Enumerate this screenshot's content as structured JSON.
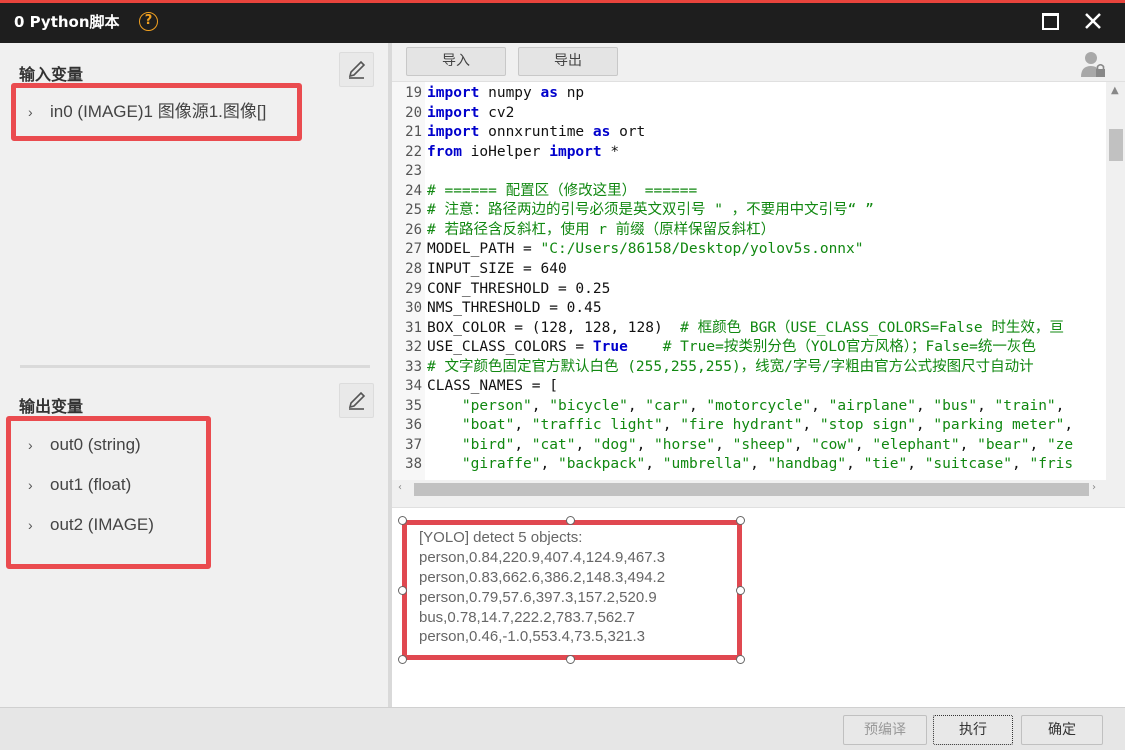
{
  "window": {
    "title": "0 Python脚本",
    "help_glyph": "?"
  },
  "inputs": {
    "title": "输入变量",
    "items": [
      {
        "label": "in0 (IMAGE)1 图像源1.图像[]"
      }
    ]
  },
  "outputs": {
    "title": "输出变量",
    "items": [
      {
        "label": "out0 (string)"
      },
      {
        "label": "out1 (float)"
      },
      {
        "label": "out2 (IMAGE)"
      }
    ]
  },
  "toolbar": {
    "import_label": "导入",
    "export_label": "导出"
  },
  "code": {
    "lines": [
      {
        "n": "19",
        "segs": [
          {
            "t": "import",
            "c": "kw"
          },
          {
            "t": " numpy ",
            "c": ""
          },
          {
            "t": "as",
            "c": "kw"
          },
          {
            "t": " np",
            "c": ""
          }
        ]
      },
      {
        "n": "20",
        "segs": [
          {
            "t": "import",
            "c": "kw"
          },
          {
            "t": " cv2",
            "c": ""
          }
        ]
      },
      {
        "n": "21",
        "segs": [
          {
            "t": "import",
            "c": "kw"
          },
          {
            "t": " onnxruntime ",
            "c": ""
          },
          {
            "t": "as",
            "c": "kw"
          },
          {
            "t": " ort",
            "c": ""
          }
        ]
      },
      {
        "n": "22",
        "segs": [
          {
            "t": "from",
            "c": "kw"
          },
          {
            "t": " ioHelper ",
            "c": ""
          },
          {
            "t": "import",
            "c": "kw"
          },
          {
            "t": " *",
            "c": ""
          }
        ]
      },
      {
        "n": "23",
        "segs": []
      },
      {
        "n": "24",
        "segs": [
          {
            "t": "# ====== 配置区（修改这里） ======",
            "c": "cm"
          }
        ]
      },
      {
        "n": "25",
        "segs": [
          {
            "t": "# 注意：路径两边的引号必须是英文双引号 \" ，不要用中文引号“ ”",
            "c": "cm"
          }
        ]
      },
      {
        "n": "26",
        "segs": [
          {
            "t": "# 若路径含反斜杠，使用 r 前缀（原样保留反斜杠）",
            "c": "cm"
          }
        ]
      },
      {
        "n": "27",
        "segs": [
          {
            "t": "MODEL_PATH = ",
            "c": ""
          },
          {
            "t": "\"C:/Users/86158/Desktop/yolov5s.onnx\"",
            "c": "st"
          }
        ]
      },
      {
        "n": "28",
        "segs": [
          {
            "t": "INPUT_SIZE = 640",
            "c": ""
          }
        ]
      },
      {
        "n": "29",
        "segs": [
          {
            "t": "CONF_THRESHOLD = 0.25",
            "c": ""
          }
        ]
      },
      {
        "n": "30",
        "segs": [
          {
            "t": "NMS_THRESHOLD = 0.45",
            "c": ""
          }
        ]
      },
      {
        "n": "31",
        "segs": [
          {
            "t": "BOX_COLOR = (128, 128, 128)  ",
            "c": ""
          },
          {
            "t": "# 框颜色 BGR（USE_CLASS_COLORS=False 时生效，亘",
            "c": "cm"
          }
        ]
      },
      {
        "n": "32",
        "segs": [
          {
            "t": "USE_CLASS_COLORS = ",
            "c": ""
          },
          {
            "t": "True",
            "c": "kw"
          },
          {
            "t": "    ",
            "c": ""
          },
          {
            "t": "# True=按类别分色（YOLO官方风格）；False=统一灰色",
            "c": "cm"
          }
        ]
      },
      {
        "n": "33",
        "segs": [
          {
            "t": "# 文字颜色固定官方默认白色 (255,255,255)，线宽/字号/字粗由官方公式按图尺寸自动计",
            "c": "cm"
          }
        ]
      },
      {
        "n": "34",
        "segs": [
          {
            "t": "CLASS_NAMES = [",
            "c": ""
          }
        ]
      },
      {
        "n": "35",
        "segs": [
          {
            "t": "    ",
            "c": ""
          },
          {
            "t": "\"person\"",
            "c": "st"
          },
          {
            "t": ", ",
            "c": ""
          },
          {
            "t": "\"bicycle\"",
            "c": "st"
          },
          {
            "t": ", ",
            "c": ""
          },
          {
            "t": "\"car\"",
            "c": "st"
          },
          {
            "t": ", ",
            "c": ""
          },
          {
            "t": "\"motorcycle\"",
            "c": "st"
          },
          {
            "t": ", ",
            "c": ""
          },
          {
            "t": "\"airplane\"",
            "c": "st"
          },
          {
            "t": ", ",
            "c": ""
          },
          {
            "t": "\"bus\"",
            "c": "st"
          },
          {
            "t": ", ",
            "c": ""
          },
          {
            "t": "\"train\"",
            "c": "st"
          },
          {
            "t": ",",
            "c": ""
          }
        ]
      },
      {
        "n": "36",
        "segs": [
          {
            "t": "    ",
            "c": ""
          },
          {
            "t": "\"boat\"",
            "c": "st"
          },
          {
            "t": ", ",
            "c": ""
          },
          {
            "t": "\"traffic light\"",
            "c": "st"
          },
          {
            "t": ", ",
            "c": ""
          },
          {
            "t": "\"fire hydrant\"",
            "c": "st"
          },
          {
            "t": ", ",
            "c": ""
          },
          {
            "t": "\"stop sign\"",
            "c": "st"
          },
          {
            "t": ", ",
            "c": ""
          },
          {
            "t": "\"parking meter\"",
            "c": "st"
          },
          {
            "t": ",",
            "c": ""
          }
        ]
      },
      {
        "n": "37",
        "segs": [
          {
            "t": "    ",
            "c": ""
          },
          {
            "t": "\"bird\"",
            "c": "st"
          },
          {
            "t": ", ",
            "c": ""
          },
          {
            "t": "\"cat\"",
            "c": "st"
          },
          {
            "t": ", ",
            "c": ""
          },
          {
            "t": "\"dog\"",
            "c": "st"
          },
          {
            "t": ", ",
            "c": ""
          },
          {
            "t": "\"horse\"",
            "c": "st"
          },
          {
            "t": ", ",
            "c": ""
          },
          {
            "t": "\"sheep\"",
            "c": "st"
          },
          {
            "t": ", ",
            "c": ""
          },
          {
            "t": "\"cow\"",
            "c": "st"
          },
          {
            "t": ", ",
            "c": ""
          },
          {
            "t": "\"elephant\"",
            "c": "st"
          },
          {
            "t": ", ",
            "c": ""
          },
          {
            "t": "\"bear\"",
            "c": "st"
          },
          {
            "t": ", ",
            "c": ""
          },
          {
            "t": "\"ze",
            "c": "st"
          }
        ]
      },
      {
        "n": "38",
        "segs": [
          {
            "t": "    ",
            "c": ""
          },
          {
            "t": "\"giraffe\"",
            "c": "st"
          },
          {
            "t": ", ",
            "c": ""
          },
          {
            "t": "\"backpack\"",
            "c": "st"
          },
          {
            "t": ", ",
            "c": ""
          },
          {
            "t": "\"umbrella\"",
            "c": "st"
          },
          {
            "t": ", ",
            "c": ""
          },
          {
            "t": "\"handbag\"",
            "c": "st"
          },
          {
            "t": ", ",
            "c": ""
          },
          {
            "t": "\"tie\"",
            "c": "st"
          },
          {
            "t": ", ",
            "c": ""
          },
          {
            "t": "\"suitcase\"",
            "c": "st"
          },
          {
            "t": ", ",
            "c": ""
          },
          {
            "t": "\"fris",
            "c": "st"
          }
        ]
      }
    ]
  },
  "output": {
    "lines": [
      "[YOLO] detect 5 objects:",
      "person,0.84,220.9,407.4,124.9,467.3",
      "person,0.83,662.6,386.2,148.3,494.2",
      "person,0.79,57.6,397.3,157.2,520.9",
      "bus,0.78,14.7,222.2,783.7,562.7",
      "person,0.46,-1.0,553.4,73.5,321.3"
    ]
  },
  "footer": {
    "precompile_label": "预编译",
    "run_label": "执行",
    "ok_label": "确定"
  },
  "colors": {
    "titlebar": "#1e1e1e",
    "accent_red": "#e8443c",
    "keyword": "#0000cc",
    "comment": "#118811"
  }
}
